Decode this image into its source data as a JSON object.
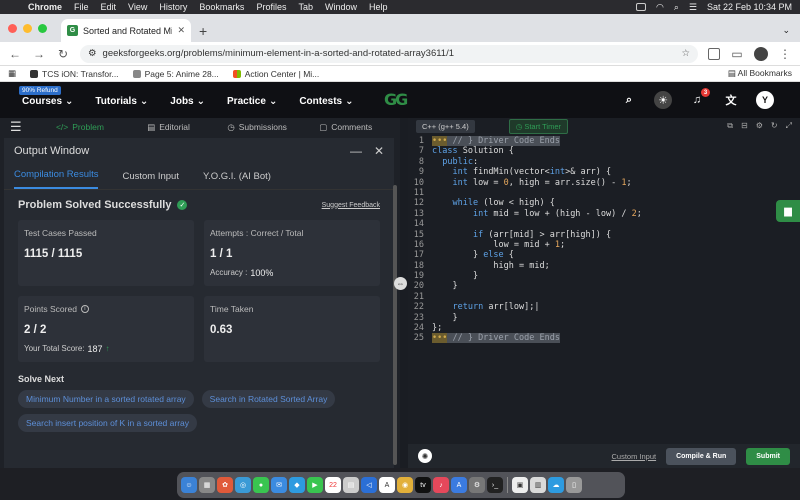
{
  "menubar": {
    "app": "Chrome",
    "items": [
      "File",
      "Edit",
      "View",
      "History",
      "Bookmarks",
      "Profiles",
      "Tab",
      "Window",
      "Help"
    ],
    "datetime": "Sat 22 Feb  10:34 PM"
  },
  "browser": {
    "tab_title": "Sorted and Rotated Minimum",
    "url": "geeksforgeeks.org/problems/minimum-element-in-a-sorted-and-rotated-array3611/1",
    "bookmarks": [
      "TCS iON: Transfor...",
      "Page 5: Anime 28...",
      "Action Center | Mi..."
    ],
    "all_bookmarks": "All Bookmarks"
  },
  "site_header": {
    "refund_badge": "90% Refund",
    "nav": [
      "Courses",
      "Tutorials",
      "Jobs",
      "Practice",
      "Contests"
    ],
    "notification_count": "3",
    "avatar_letter": "Y"
  },
  "problem_nav": {
    "tabs": [
      "Problem",
      "Editorial",
      "Submissions",
      "Comments"
    ]
  },
  "output_window": {
    "title": "Output Window",
    "tabs": [
      "Compilation Results",
      "Custom Input",
      "Y.O.G.I. (AI Bot)"
    ],
    "status": "Problem Solved Successfully",
    "feedback_link": "Suggest Feedback",
    "test_cases_label": "Test Cases Passed",
    "test_cases_value": "1115 / 1115",
    "attempts_label": "Attempts : Correct / Total",
    "attempts_value": "1 / 1",
    "accuracy_label": "Accuracy :",
    "accuracy_value": "100%",
    "points_label": "Points Scored",
    "points_value": "2 / 2",
    "total_score_label": "Your Total Score:",
    "total_score_value": "187",
    "time_label": "Time Taken",
    "time_value": "0.63",
    "solve_next_label": "Solve Next",
    "solve_next": [
      "Minimum Number in a sorted rotated array",
      "Search in Rotated Sorted Array",
      "Search insert position of K in a sorted array"
    ]
  },
  "editor": {
    "language": "C++ (g++ 5.4)",
    "timer_label": "Start Timer",
    "code_lines": [
      {
        "n": "1",
        "html": "<span class='fold'>•••</span><span class='cmt'> // } Driver Code Ends</span>"
      },
      {
        "n": "7",
        "html": "<span class='kw'>class</span> Solution {"
      },
      {
        "n": "8",
        "html": "  <span class='kw'>public</span>:"
      },
      {
        "n": "9",
        "html": "    <span class='ty'>int</span> findMin(vector&lt;<span class='ty'>int</span>&gt;&amp; arr) {"
      },
      {
        "n": "10",
        "html": "    <span class='ty'>int</span> low = <span class='num'>0</span>, high = arr.size() - <span class='num'>1</span>;"
      },
      {
        "n": "11",
        "html": ""
      },
      {
        "n": "12",
        "html": "    <span class='kw'>while</span> (low &lt; high) {"
      },
      {
        "n": "13",
        "html": "        <span class='ty'>int</span> mid = low + (high - low) / <span class='num'>2</span>;"
      },
      {
        "n": "14",
        "html": ""
      },
      {
        "n": "15",
        "html": "        <span class='kw'>if</span> (arr[mid] &gt; arr[high]) {"
      },
      {
        "n": "16",
        "html": "            low = mid + <span class='num'>1</span>;"
      },
      {
        "n": "17",
        "html": "        } <span class='kw'>else</span> {"
      },
      {
        "n": "18",
        "html": "            high = mid;"
      },
      {
        "n": "19",
        "html": "        }"
      },
      {
        "n": "20",
        "html": "    }"
      },
      {
        "n": "21",
        "html": ""
      },
      {
        "n": "22",
        "html": "    <span class='kw'>return</span> arr[low];|"
      },
      {
        "n": "23",
        "html": "    }"
      },
      {
        "n": "24",
        "html": "};"
      },
      {
        "n": "25",
        "html": "<span class='fold'>•••</span><span class='cmt'> // } Driver Code Ends</span>"
      }
    ],
    "custom_input": "Custom Input",
    "compile_run": "Compile & Run",
    "submit": "Submit"
  },
  "colors": {
    "brand_green": "#2f8d46",
    "link_blue": "#3b8be0"
  }
}
